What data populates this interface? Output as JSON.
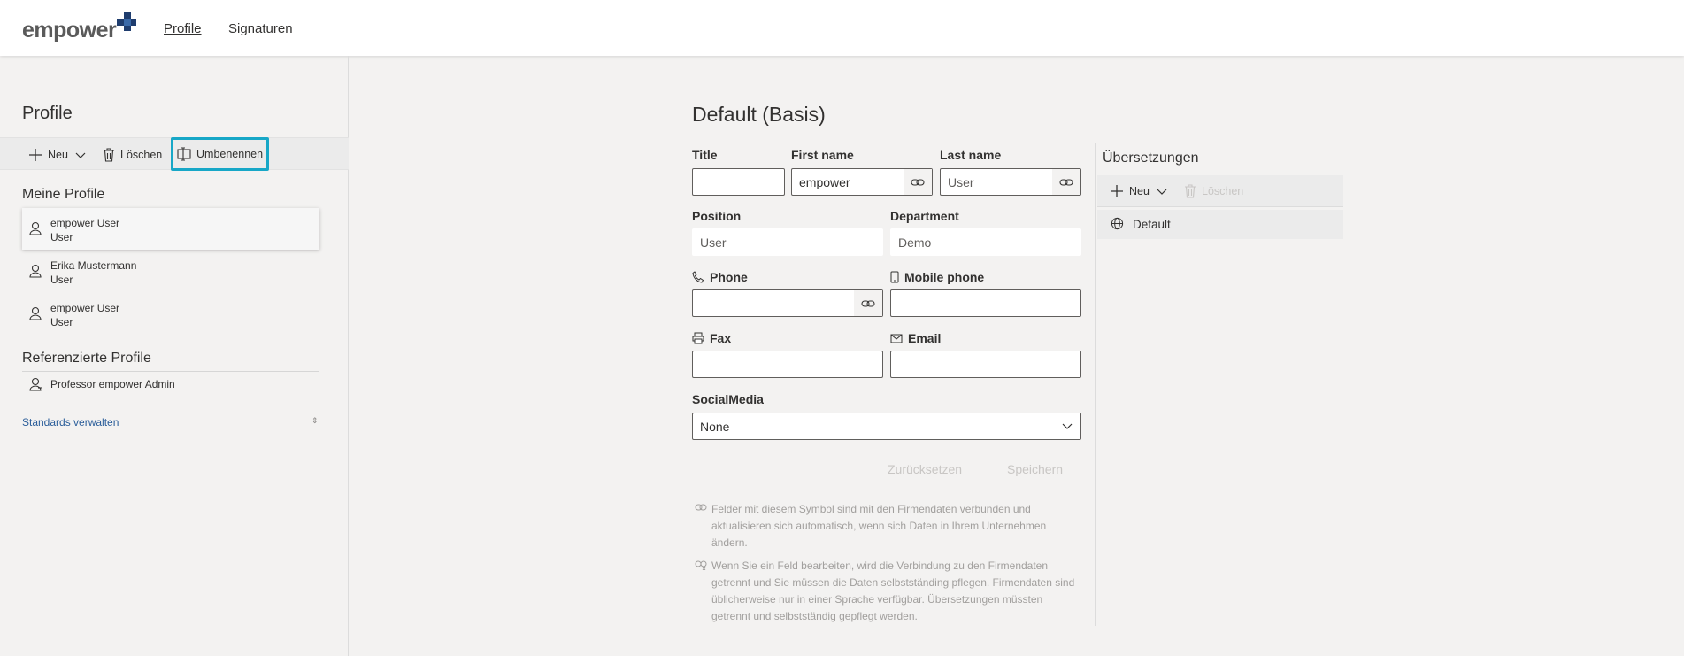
{
  "header": {
    "logo_text": "empower",
    "nav": [
      {
        "label": "Profile",
        "active": true
      },
      {
        "label": "Signaturen",
        "active": false
      }
    ]
  },
  "left": {
    "title": "Profile",
    "commands": {
      "new": "Neu",
      "delete": "Löschen",
      "rename": "Umbenennen"
    },
    "my_profiles_title": "Meine Profile",
    "my_profiles": [
      {
        "name": "empower User",
        "sub": "User",
        "selected": true
      },
      {
        "name": "Erika Mustermann",
        "sub": "User",
        "selected": false
      },
      {
        "name": "empower User",
        "sub": "User",
        "selected": false
      }
    ],
    "referenced_title": "Referenzierte Profile",
    "referenced": [
      {
        "name": "Professor empower Admin"
      }
    ],
    "manage_link": "Standards verwalten"
  },
  "form": {
    "title": "Default (Basis)",
    "labels": {
      "title": "Title",
      "first_name": "First name",
      "last_name": "Last name",
      "position": "Position",
      "department": "Department",
      "phone": "Phone",
      "mobile": "Mobile phone",
      "fax": "Fax",
      "email": "Email",
      "social": "SocialMedia"
    },
    "values": {
      "title": "",
      "first_name": "empower",
      "last_name": "User",
      "position": "User",
      "department": "Demo",
      "phone": "",
      "mobile": "",
      "fax": "",
      "email": "",
      "social": "None"
    },
    "buttons": {
      "reset": "Zurücksetzen",
      "save": "Speichern"
    },
    "hints": [
      "Felder mit diesem Symbol sind mit den Firmendaten verbunden und aktualisieren sich automatisch, wenn sich Daten in Ihrem Unternehmen ändern.",
      "Wenn Sie ein Feld bearbeiten, wird die Verbindung zu den Firmendaten getrennt und Sie müssen die Daten selbstständing pflegen. Firmendaten sind üblicherweise nur in einer Sprache verfügbar. Übersetzungen müssten getrennt und selbstständig gepflegt werden."
    ]
  },
  "translations": {
    "title": "Übersetzungen",
    "commands": {
      "new": "Neu",
      "delete": "Löschen"
    },
    "items": [
      {
        "label": "Default"
      }
    ]
  },
  "colors": {
    "accent": "#17a7c7",
    "logo_mark": "#1f3d6e",
    "link": "#2b5e9a"
  }
}
